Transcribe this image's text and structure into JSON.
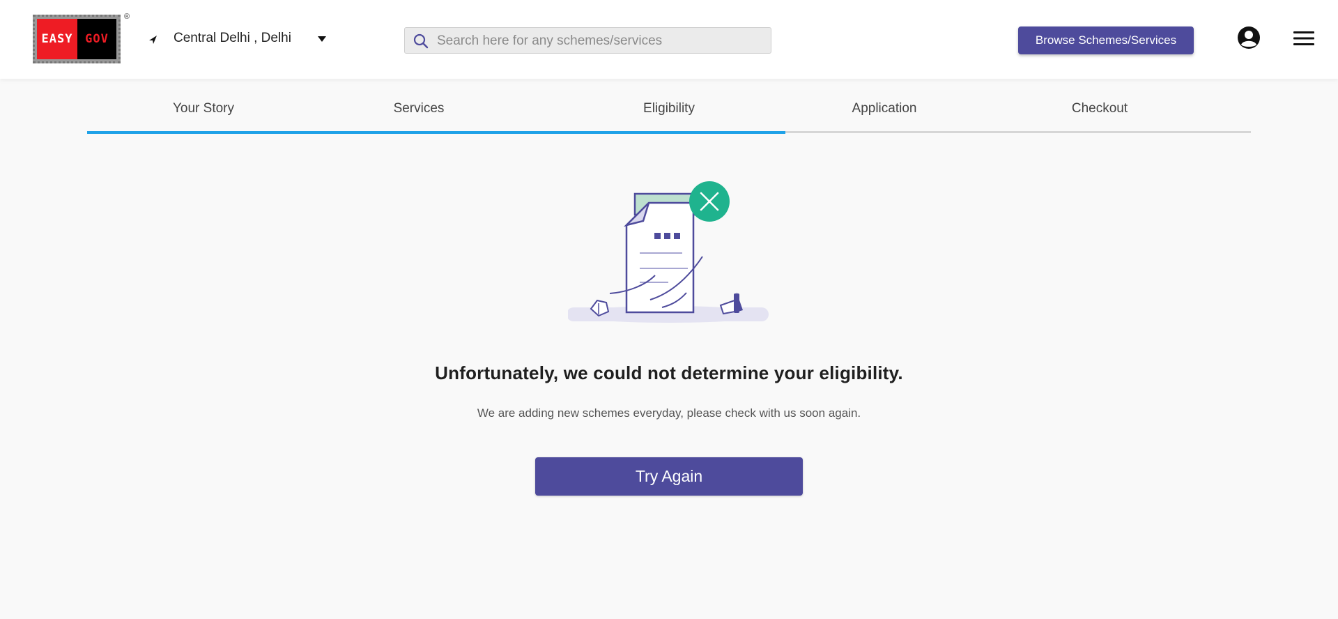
{
  "header": {
    "logo": {
      "left_text": "EASY",
      "right_text": "GOV",
      "reg": "®"
    },
    "location": "Central Delhi , Delhi",
    "search": {
      "placeholder": "Search here for any schemes/services",
      "value": ""
    },
    "browse_button": "Browse Schemes/Services",
    "icons": [
      "location-arrow-icon",
      "caret-down-icon",
      "search-icon",
      "user-icon",
      "menu-icon"
    ]
  },
  "steps": {
    "items": [
      {
        "label": "Your Story"
      },
      {
        "label": "Services"
      },
      {
        "label": "Eligibility"
      },
      {
        "label": "Application"
      },
      {
        "label": "Checkout"
      }
    ],
    "current_step": "Eligibility",
    "progress_fraction": 0.6
  },
  "result": {
    "title": "Unfortunately, we could not determine your eligibility.",
    "subtitle": "We are adding new schemes everyday, please check with us soon again.",
    "try_again_button": "Try Again"
  },
  "colors": {
    "primary": "#4e4b9c",
    "progress": "#1fa2e8",
    "error_badge": "#1fb38e",
    "logo_red": "#ee1c24"
  }
}
